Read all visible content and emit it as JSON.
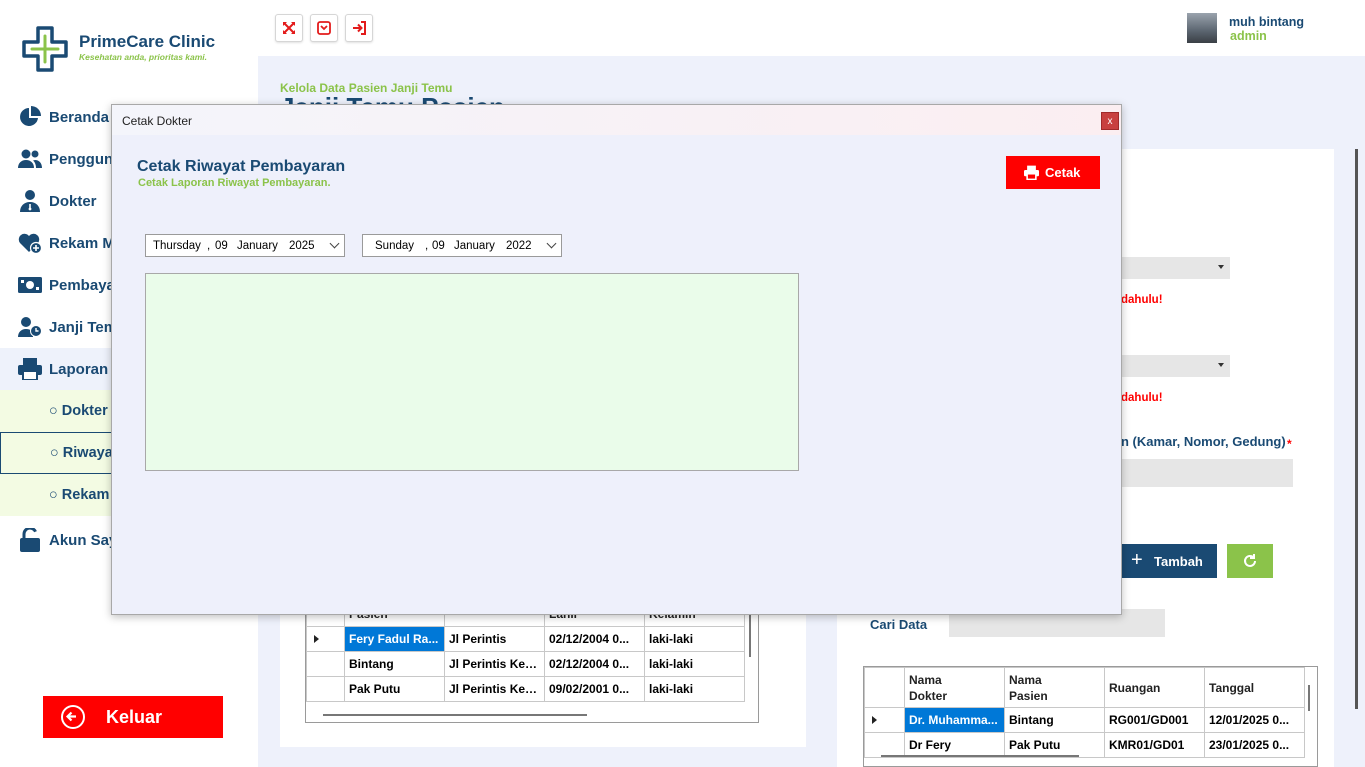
{
  "app": {
    "name": "PrimeCare Clinic",
    "tagline": "Kesehatan anda, prioritas kami."
  },
  "user": {
    "name": "muh bintang",
    "role": "admin"
  },
  "sidebar": {
    "items": [
      {
        "label": "Beranda",
        "icon": "pie-chart-icon"
      },
      {
        "label": "Penggun",
        "icon": "users-icon"
      },
      {
        "label": "Dokter",
        "icon": "doctor-icon"
      },
      {
        "label": "Rekam M",
        "icon": "heart-plus-icon"
      },
      {
        "label": "Pembaya",
        "icon": "money-icon"
      },
      {
        "label": "Janji Tem",
        "icon": "user-clock-icon"
      },
      {
        "label": "Laporan",
        "icon": "printer-icon"
      }
    ],
    "sub_items": [
      {
        "label": "○ Dokter"
      },
      {
        "label": "○ Riwayat"
      },
      {
        "label": "○ Rekam"
      }
    ],
    "account": {
      "label": "Akun Say",
      "icon": "unlock-icon"
    },
    "logout_label": "Keluar"
  },
  "page": {
    "breadcrumb": "Kelola Data Pasien  Janji Temu",
    "title": "Janji Temu Pasien"
  },
  "form": {
    "warning_1": "dahulu!",
    "warning_2": "dahulu!",
    "address_label": "n (Kamar, Nomor, Gedung)",
    "required_mark": "*",
    "add_button": "Tambah",
    "search_label": "Cari Data"
  },
  "patient_table": {
    "headers": [
      "Pasien",
      "",
      "Lahir",
      "Kelamin"
    ],
    "rows": [
      [
        "Fery Fadul Ra...",
        "Jl Perintis",
        "02/12/2004 0...",
        "laki-laki"
      ],
      [
        "Bintang",
        "Jl Perintis Kem...",
        "02/12/2004 0...",
        "laki-laki"
      ],
      [
        "Pak Putu",
        "Jl Perintis Kem...",
        "09/02/2001 0...",
        "laki-laki"
      ]
    ]
  },
  "appointment_table": {
    "headers": [
      "Nama\nDokter",
      "Nama\nPasien",
      "Ruangan",
      "Tanggal"
    ],
    "rows": [
      [
        "Dr. Muhamma...",
        "Bintang",
        "RG001/GD001",
        "12/01/2025 0..."
      ],
      [
        "Dr Fery",
        "Pak Putu",
        "KMR01/GD01",
        "23/01/2025 0..."
      ]
    ]
  },
  "modal": {
    "window_title": "Cetak Dokter",
    "close_label": "x",
    "heading": "Cetak Riwayat Pembayaran",
    "subheading": "Cetak Laporan Riwayat Pembayaran.",
    "print_button": "Cetak",
    "date_from": {
      "day_name": "Thursday",
      "day": "09",
      "month": "January",
      "year": "2025"
    },
    "date_to": {
      "day_name": "Sunday",
      "day": "09",
      "month": "January",
      "year": "2022"
    }
  },
  "colors": {
    "primary": "#1a4a73",
    "accent": "#8bc34a",
    "danger": "#ff0000",
    "selection": "#0078d7"
  }
}
